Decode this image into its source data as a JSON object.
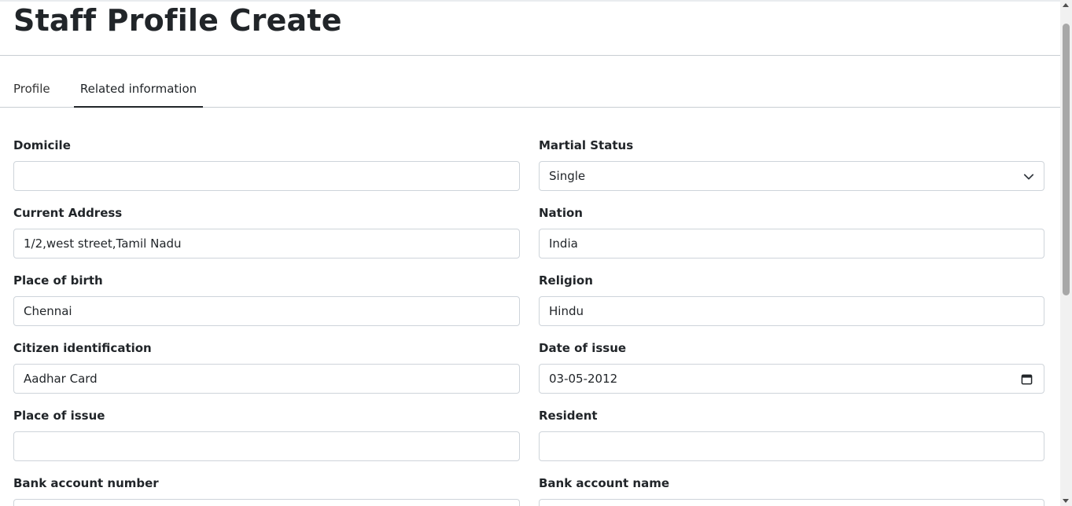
{
  "page": {
    "title": "Staff Profile Create"
  },
  "tabs": [
    {
      "label": "Profile",
      "active": false
    },
    {
      "label": "Related information",
      "active": true
    }
  ],
  "form": {
    "domicile": {
      "label": "Domicile",
      "value": ""
    },
    "marital_status": {
      "label": "Martial Status",
      "value": "Single"
    },
    "current_address": {
      "label": "Current Address",
      "value": "1/2,west street,Tamil Nadu"
    },
    "nation": {
      "label": "Nation",
      "value": "India"
    },
    "place_of_birth": {
      "label": "Place of birth",
      "value": "Chennai"
    },
    "religion": {
      "label": "Religion",
      "value": "Hindu"
    },
    "citizen_identification": {
      "label": "Citizen identification",
      "value": "Aadhar Card"
    },
    "date_of_issue": {
      "label": "Date of issue",
      "value": "03-05-2012"
    },
    "place_of_issue": {
      "label": "Place of issue",
      "value": ""
    },
    "resident": {
      "label": "Resident",
      "value": ""
    },
    "bank_account_number": {
      "label": "Bank account number",
      "value": ""
    },
    "bank_account_name": {
      "label": "Bank account name",
      "value": ""
    }
  },
  "icons": {
    "select_arrow": "chevron-down-icon",
    "date_picker": "calendar-icon"
  },
  "colors": {
    "text": "#212529",
    "border": "#ced4da",
    "divider": "#c9ced3"
  }
}
